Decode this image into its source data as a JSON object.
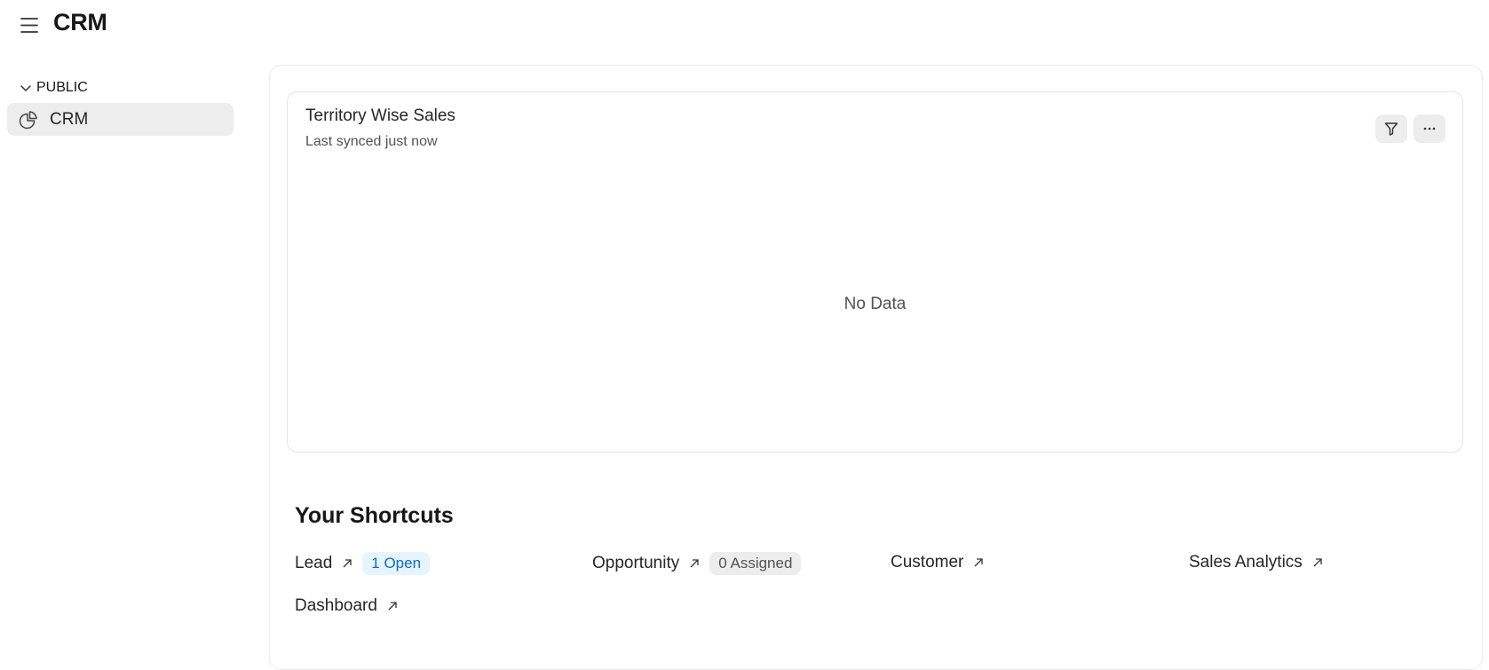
{
  "app": {
    "title": "CRM"
  },
  "sidebar": {
    "section_label": "PUBLIC",
    "items": [
      {
        "label": "CRM",
        "icon": "pie-chart-icon"
      }
    ]
  },
  "chart_card": {
    "title": "Territory Wise Sales",
    "subtitle": "Last synced just now",
    "empty_text": "No Data"
  },
  "shortcuts": {
    "title": "Your Shortcuts",
    "items": [
      {
        "label": "Lead",
        "badge": "1 Open",
        "badge_color": "#0b6bcb"
      },
      {
        "label": "Opportunity",
        "badge": "0 Assigned",
        "badge_color": "#525252"
      },
      {
        "label": "Customer"
      },
      {
        "label": "Sales Analytics"
      },
      {
        "label": "Dashboard"
      }
    ]
  }
}
